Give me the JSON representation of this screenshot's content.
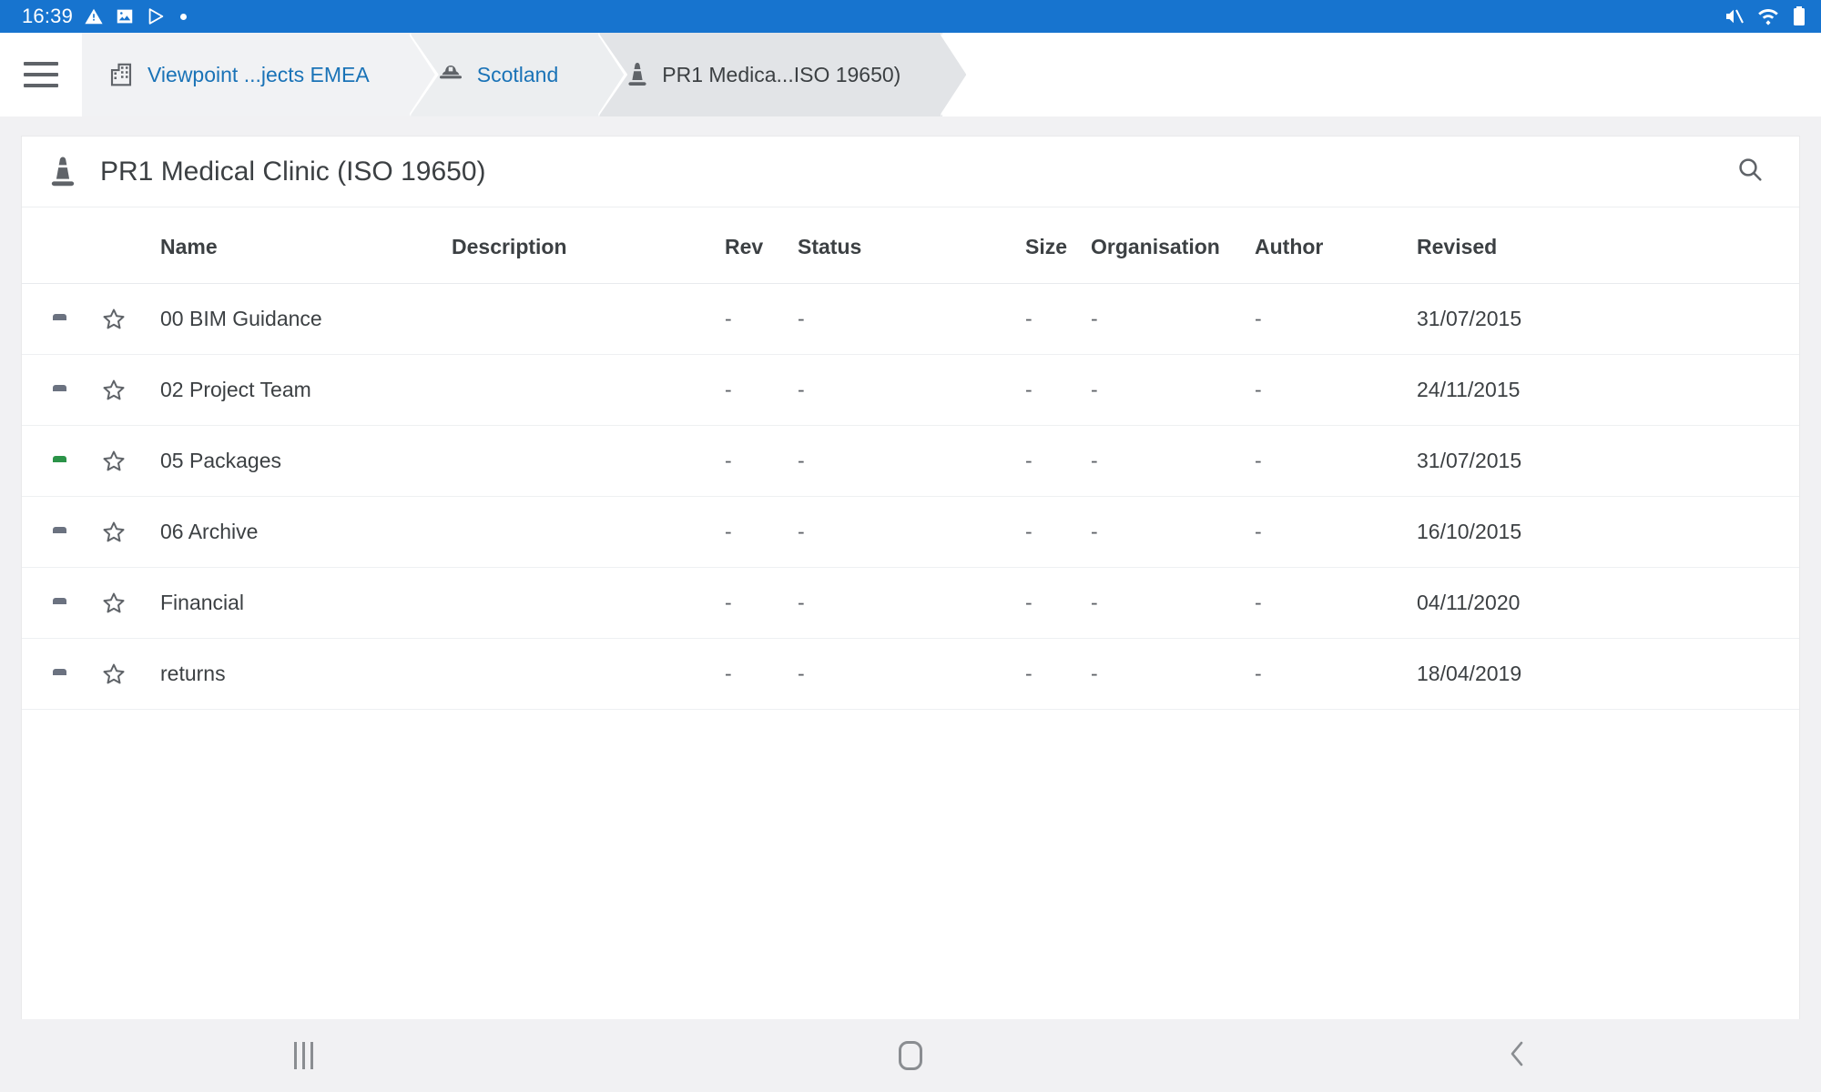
{
  "statusbar": {
    "time": "16:39",
    "left_icons": [
      "warning-triangle-icon",
      "image-icon",
      "play-store-icon",
      "dot-icon"
    ],
    "right_icons": [
      "volume-muted-icon",
      "wifi-icon",
      "battery-icon"
    ],
    "background_color": "#1774cf"
  },
  "breadcrumb": {
    "menu_label": "menu",
    "items": [
      {
        "label": "Viewpoint ...jects EMEA",
        "icon": "building-icon",
        "active": false
      },
      {
        "label": "Scotland",
        "icon": "hardhat-icon",
        "active": false
      },
      {
        "label": "PR1 Medica...ISO 19650)",
        "icon": "traffic-cone-icon",
        "active": true
      }
    ],
    "link_color": "#1a73b7"
  },
  "header": {
    "title": "PR1 Medical Clinic (ISO 19650)",
    "title_icon": "traffic-cone-icon",
    "search_icon": "search-icon"
  },
  "table": {
    "columns": [
      "Name",
      "Description",
      "Rev",
      "Status",
      "Size",
      "Organisation",
      "Author",
      "Revised"
    ],
    "rows": [
      {
        "icon": "folder-icon",
        "star": "star-outline-icon",
        "name": "00 BIM Guidance",
        "description": "",
        "rev": "-",
        "status": "-",
        "size": "-",
        "organisation": "-",
        "author": "-",
        "revised": "31/07/2015"
      },
      {
        "icon": "folder-icon",
        "star": "star-outline-icon",
        "name": "02 Project Team",
        "description": "",
        "rev": "-",
        "status": "-",
        "size": "-",
        "organisation": "-",
        "author": "-",
        "revised": "24/11/2015"
      },
      {
        "icon": "folder-sync-icon",
        "star": "star-outline-icon",
        "name": "05 Packages",
        "description": "",
        "rev": "-",
        "status": "-",
        "size": "-",
        "organisation": "-",
        "author": "-",
        "revised": "31/07/2015"
      },
      {
        "icon": "folder-icon",
        "star": "star-outline-icon",
        "name": "06 Archive",
        "description": "",
        "rev": "-",
        "status": "-",
        "size": "-",
        "organisation": "-",
        "author": "-",
        "revised": "16/10/2015"
      },
      {
        "icon": "folder-icon",
        "star": "star-outline-icon",
        "name": "Financial",
        "description": "",
        "rev": "-",
        "status": "-",
        "size": "-",
        "organisation": "-",
        "author": "-",
        "revised": "04/11/2020"
      },
      {
        "icon": "folder-icon",
        "star": "star-outline-icon",
        "name": "returns",
        "description": "",
        "rev": "-",
        "status": "-",
        "size": "-",
        "organisation": "-",
        "author": "-",
        "revised": "18/04/2019"
      }
    ],
    "sync_folder_color": "#2b9348",
    "folder_color": "#6b7280"
  },
  "navbar": {
    "items": [
      {
        "name": "recents-button",
        "icon": "recents-icon"
      },
      {
        "name": "home-button",
        "icon": "home-icon"
      },
      {
        "name": "back-button",
        "icon": "back-chevron-icon"
      }
    ]
  }
}
